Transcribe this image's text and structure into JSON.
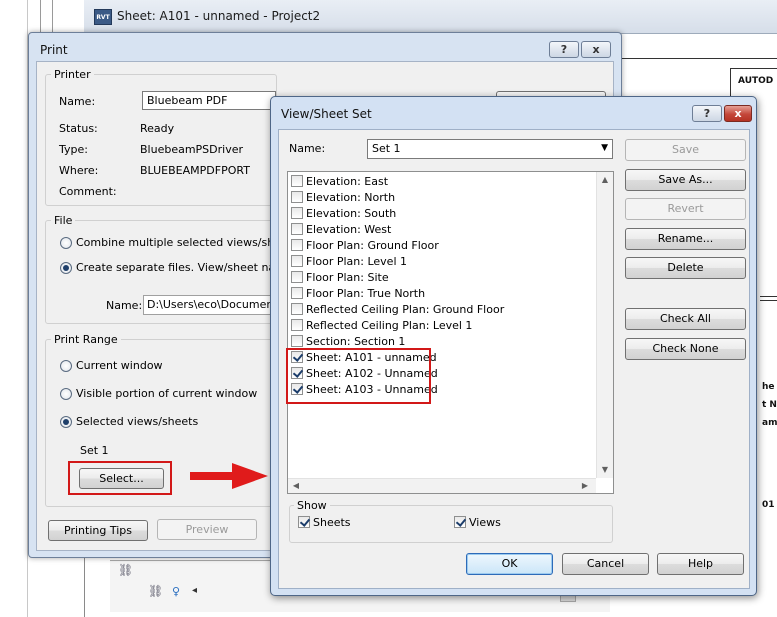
{
  "background_window": {
    "title": "Sheet: A101 - unnamed - Project2",
    "app_icon": "RVT",
    "titleblock_label": "AUTOD",
    "titleblock_fragments": [
      "he",
      "t N",
      "am",
      "01"
    ]
  },
  "print_dialog": {
    "title": "Print",
    "help_label": "?",
    "close_label": "x",
    "printer": {
      "group_label": "Printer",
      "name_label": "Name:",
      "name_value": "Bluebeam PDF",
      "status_label": "Status:",
      "status_value": "Ready",
      "type_label": "Type:",
      "type_value": "BluebeamPSDriver",
      "where_label": "Where:",
      "where_value": "BLUEBEAMPDFPORT",
      "comment_label": "Comment:"
    },
    "file": {
      "group_label": "File",
      "combine_label": "Combine multiple selected views/sheets i",
      "separate_label": "Create separate files. View/sheet names",
      "name_label": "Name:",
      "name_value": "D:\\Users\\eco\\Documents"
    },
    "print_range": {
      "group_label": "Print Range",
      "current_window_label": "Current window",
      "visible_portion_label": "Visible portion of current window",
      "selected_label": "Selected views/sheets",
      "set_name": "Set 1",
      "select_button": "Select..."
    },
    "printing_tips_button": "Printing Tips",
    "preview_button": "Preview"
  },
  "view_sheet_set_dialog": {
    "title": "View/Sheet Set",
    "help_label": "?",
    "close_label": "x",
    "name_label": "Name:",
    "name_value": "Set 1",
    "items": [
      {
        "label": "Elevation: East",
        "checked": false
      },
      {
        "label": "Elevation: North",
        "checked": false
      },
      {
        "label": "Elevation: South",
        "checked": false
      },
      {
        "label": "Elevation: West",
        "checked": false
      },
      {
        "label": "Floor Plan: Ground Floor",
        "checked": false
      },
      {
        "label": "Floor Plan: Level 1",
        "checked": false
      },
      {
        "label": "Floor Plan: Site",
        "checked": false
      },
      {
        "label": "Floor Plan: True North",
        "checked": false
      },
      {
        "label": "Reflected Ceiling Plan: Ground Floor",
        "checked": false
      },
      {
        "label": "Reflected Ceiling Plan: Level 1",
        "checked": false
      },
      {
        "label": "Section: Section 1",
        "checked": false
      },
      {
        "label": "Sheet: A101 - unnamed",
        "checked": true
      },
      {
        "label": "Sheet: A102 - Unnamed",
        "checked": true
      },
      {
        "label": "Sheet: A103 - Unnamed",
        "checked": true
      }
    ],
    "buttons": {
      "save": "Save",
      "save_as": "Save As...",
      "revert": "Revert",
      "rename": "Rename...",
      "delete": "Delete",
      "check_all": "Check All",
      "check_none": "Check None",
      "ok": "OK",
      "cancel": "Cancel",
      "help": "Help"
    },
    "show": {
      "group_label": "Show",
      "sheets_label": "Sheets",
      "sheets_checked": true,
      "views_label": "Views",
      "views_checked": true
    }
  },
  "colors": {
    "highlight_red": "#d21818",
    "dialog_frame": "#d3e1f3",
    "client_bg": "#f0f0f0"
  }
}
